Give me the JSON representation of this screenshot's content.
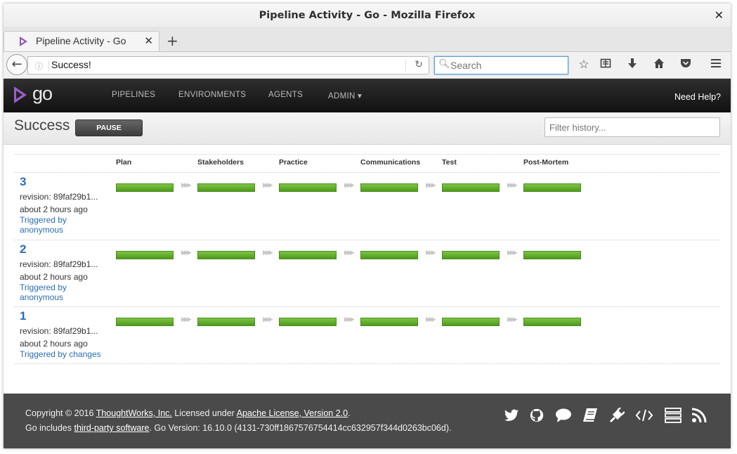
{
  "window": {
    "title": "Pipeline Activity - Go - Mozilla Firefox",
    "close_glyph": "✕"
  },
  "tab": {
    "title": "Pipeline Activity - Go",
    "close_glyph": "✕",
    "new_tab_glyph": "+"
  },
  "nav": {
    "back_glyph": "←",
    "info_glyph": "ⓘ",
    "url": "Success!",
    "reload_glyph": "↻",
    "search_placeholder": "Search"
  },
  "toolbar_icons": [
    "star-icon",
    "reading-list-icon",
    "download-icon",
    "home-icon",
    "pocket-icon",
    "menu-icon"
  ],
  "go_header": {
    "logo_text": "go",
    "menu": [
      "PIPELINES",
      "ENVIRONMENTS",
      "AGENTS",
      "ADMIN ▾"
    ],
    "help": "Need Help?"
  },
  "page": {
    "title": "Success",
    "pause_label": "PAUSE",
    "filter_placeholder": "Filter history..."
  },
  "stages": [
    "Plan",
    "Stakeholders",
    "Practice",
    "Communications",
    "Test",
    "Post-Mortem"
  ],
  "stage_status_color": "#6cb63a",
  "runs": [
    {
      "counter": "3",
      "revision": "revision: 89faf29b1...",
      "ago": "about 2 hours ago",
      "trigger": "Triggered by anonymous",
      "stage_status": [
        "passed",
        "passed",
        "passed",
        "passed",
        "passed",
        "passed"
      ]
    },
    {
      "counter": "2",
      "revision": "revision: 89faf29b1...",
      "ago": "about 2 hours ago",
      "trigger": "Triggered by anonymous",
      "stage_status": [
        "passed",
        "passed",
        "passed",
        "passed",
        "passed",
        "passed"
      ]
    },
    {
      "counter": "1",
      "revision": "revision: 89faf29b1...",
      "ago": "about 2 hours ago",
      "trigger": "Triggered by changes",
      "stage_status": [
        "passed",
        "passed",
        "passed",
        "passed",
        "passed",
        "passed"
      ]
    }
  ],
  "footer": {
    "copyright_prefix": "Copyright © 2016",
    "company": "ThoughtWorks, Inc.",
    "licensed": "Licensed under",
    "license": "Apache License, Version 2.0",
    "license_suffix": ".",
    "includes": "Go includes",
    "third_party": "third-party software",
    "version": ". Go Version: 16.10.0 (4131-730ff1867576754414cc632957f344d0263bc06d).",
    "icons": [
      "twitter-icon",
      "github-icon",
      "chat-icon",
      "book-icon",
      "plugin-icon",
      "api-icon",
      "server-icon",
      "rss-icon"
    ]
  }
}
